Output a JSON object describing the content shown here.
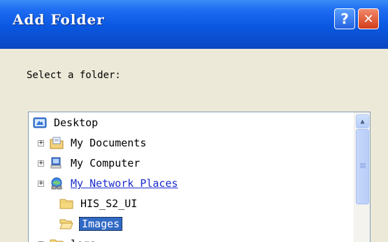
{
  "window": {
    "title": "Add Folder",
    "help_glyph": "?",
    "close_glyph": "✕"
  },
  "dialog": {
    "prompt": "Select a folder:"
  },
  "tree": {
    "items": [
      {
        "label": "Desktop",
        "icon": "desktop-icon"
      },
      {
        "label": "My Documents",
        "icon": "my-documents-icon",
        "expander": "+"
      },
      {
        "label": "My Computer",
        "icon": "my-computer-icon",
        "expander": "+"
      },
      {
        "label": "My Network Places",
        "icon": "network-places-icon",
        "expander": "+"
      },
      {
        "label": "HIS_S2_UI",
        "icon": "folder-icon"
      },
      {
        "label": "Images",
        "icon": "folder-open-icon",
        "selected": true
      },
      {
        "label": "logs",
        "icon": "folder-icon",
        "expander": "+"
      }
    ]
  },
  "scrollbar": {
    "up_glyph": "▲"
  }
}
